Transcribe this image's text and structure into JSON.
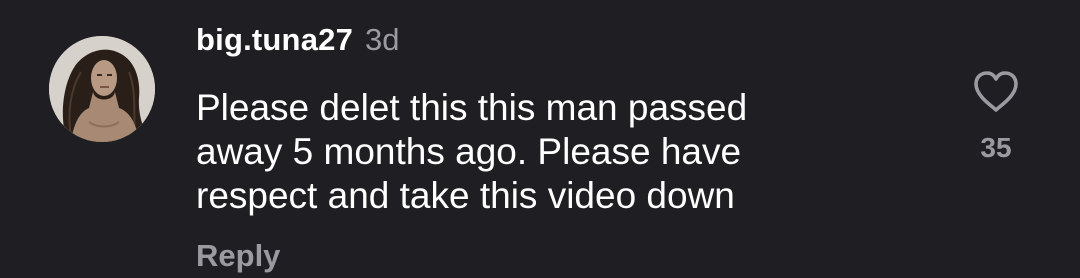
{
  "comment": {
    "username": "big.tuna27",
    "timestamp": "3d",
    "text": "Please delet this this man passed\naway 5 months ago. Please have\nrespect and take this video down",
    "reply_label": "Reply",
    "likes": "35",
    "avatar_icon": "user-avatar-photo",
    "like_icon": "heart-outline-icon"
  },
  "colors": {
    "background": "#1f1f23",
    "primary_text": "#ffffff",
    "secondary_text": "#9a9aa0"
  }
}
